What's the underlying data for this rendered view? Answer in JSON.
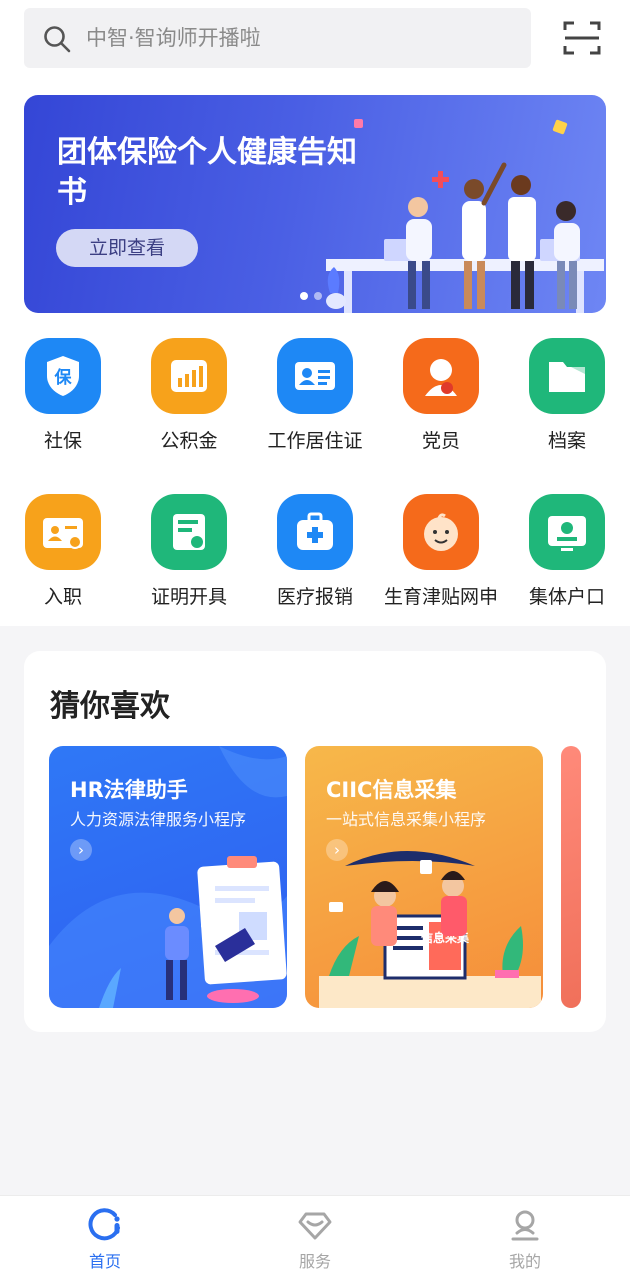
{
  "search": {
    "placeholder": "中智·智询师开播啦",
    "icon": "search-icon"
  },
  "scan": {
    "icon": "scan-icon"
  },
  "banner": {
    "title": "团体保险个人健康告知书",
    "button": "立即查看",
    "slides": 2,
    "active_slide": 1
  },
  "services": [
    {
      "label": "社保",
      "icon": "shield-icon",
      "color": "#1e88f5"
    },
    {
      "label": "公积金",
      "icon": "chart-icon",
      "color": "#f7a21b"
    },
    {
      "label": "工作居住证",
      "icon": "id-card-icon",
      "color": "#1e88f5"
    },
    {
      "label": "党员",
      "icon": "party-member-icon",
      "color": "#f56a1b"
    },
    {
      "label": "档案",
      "icon": "folder-icon",
      "color": "#1fb77a"
    },
    {
      "label": "入职",
      "icon": "badge-icon",
      "color": "#f7a21b"
    },
    {
      "label": "证明开具",
      "icon": "certificate-icon",
      "color": "#1fb77a"
    },
    {
      "label": "医疗报销",
      "icon": "medical-kit-icon",
      "color": "#1e88f5"
    },
    {
      "label": "生育津贴网申",
      "icon": "baby-icon",
      "color": "#f56a1b"
    },
    {
      "label": "集体户口",
      "icon": "household-icon",
      "color": "#1fb77a"
    }
  ],
  "guess": {
    "title": "猜你喜欢",
    "cards": [
      {
        "title": "HR法律助手",
        "subtitle": "人力资源法律服务小程序",
        "arrow": "›",
        "color": "#2f6cf4"
      },
      {
        "title": "CIIC信息采集",
        "subtitle": "一站式信息采集小程序",
        "arrow": "›",
        "color": "#f7a03a",
        "art_text": "信息采集"
      }
    ]
  },
  "tabbar": {
    "tabs": [
      {
        "label": "首页",
        "icon": "home-icon",
        "active": true
      },
      {
        "label": "服务",
        "icon": "diamond-icon",
        "active": false
      },
      {
        "label": "我的",
        "icon": "user-icon",
        "active": false
      }
    ],
    "active_color": "#2a6ff0",
    "inactive_color": "#a6a6a6"
  }
}
